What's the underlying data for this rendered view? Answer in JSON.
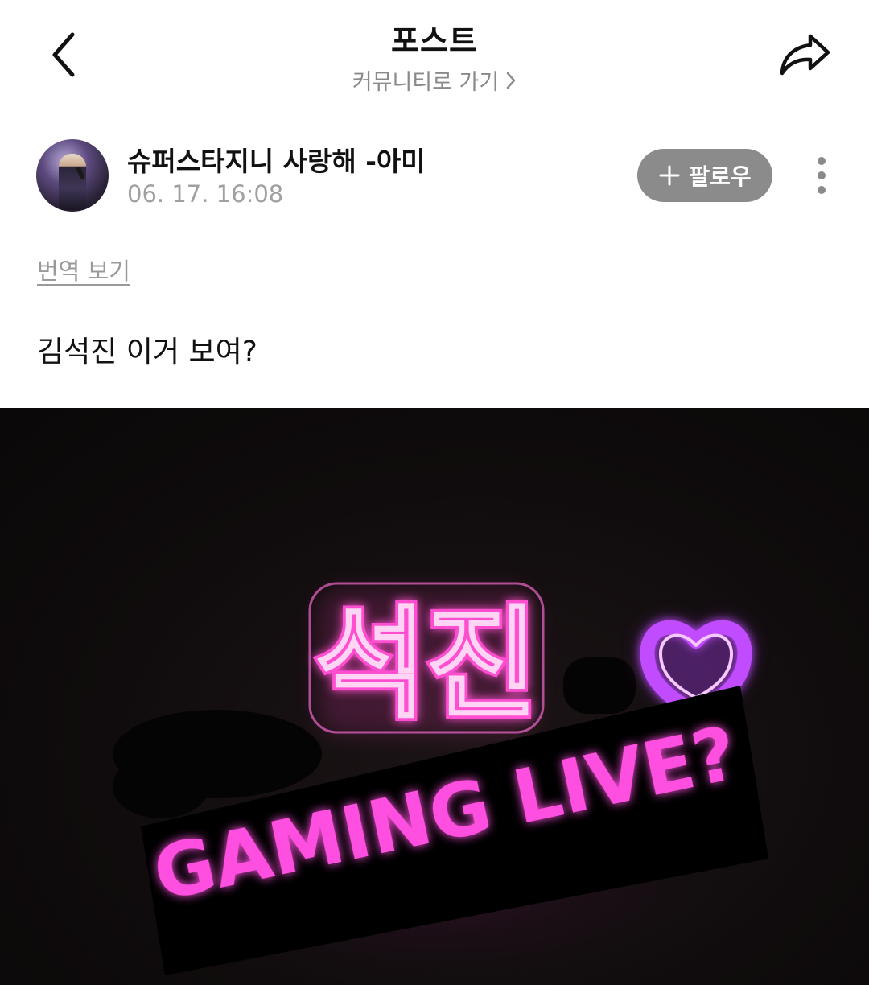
{
  "header": {
    "title": "포스트",
    "community_link": "커뮤니티로 가기"
  },
  "author": {
    "name": "슈퍼스타지니 사랑해 -아미",
    "time": "06. 17. 16:08",
    "follow_label": "팔로우"
  },
  "post": {
    "translate_label": "번역 보기",
    "text": "김석진 이거 보여?",
    "image": {
      "neon_text": "석진",
      "banner_text": "GAMING LIVE?",
      "neon_color": "#ff4fd0",
      "heart_color": "#c04bff"
    }
  },
  "icons": {
    "back": "chevron-left-icon",
    "share": "share-arrow-icon",
    "more": "more-vertical-icon",
    "plus": "plus-icon",
    "chevron": "chevron-right-icon"
  },
  "colors": {
    "follow_button_bg": "#8b8b8b",
    "muted_text": "#a0a0a0",
    "image_bg": "#0e0b0c"
  }
}
